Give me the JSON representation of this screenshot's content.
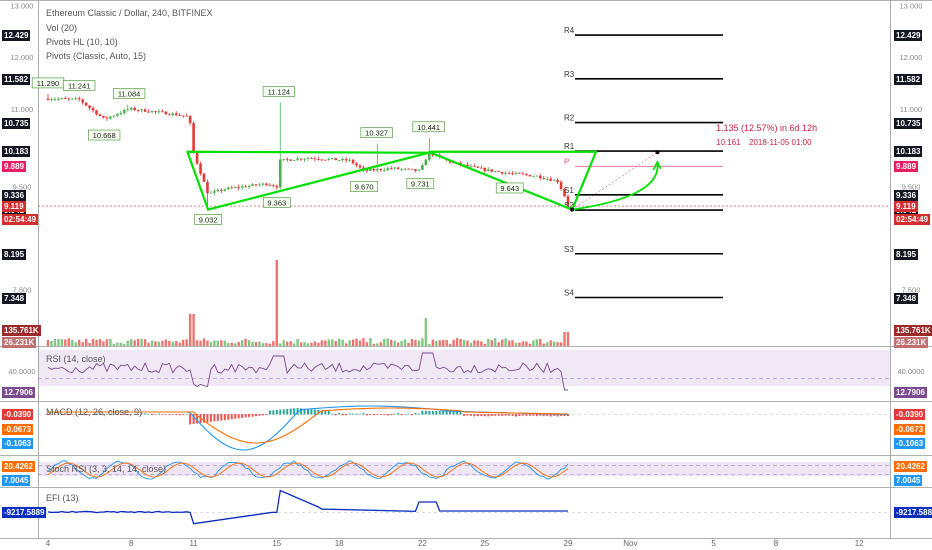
{
  "legend": {
    "title": "Ethereum Classic / Dollar, 240, BITFINEX",
    "vol": "Vol (20)",
    "pivots_hl": "Pivots HL (10, 10)",
    "pivots_classic": "Pivots (Classic, Auto, 15)",
    "rsi": "RSI (14, close)",
    "macd": "MACD (12, 26, close, 9)",
    "stoch": "Stoch RSI (3, 3, 14, 14, close)",
    "efi": "EFI (13)"
  },
  "annotation": {
    "measure": "1.135 (12.57%) in 6d 12h",
    "target_price": "10.161",
    "target_date": "2018-11-05  01:00"
  },
  "countdown": "02:54:49",
  "colors": {
    "up": "#4caf50",
    "down": "#e53935",
    "pattern": "#00e000",
    "pivot": "#000000",
    "rsi": "#7b4a8f",
    "macd": "#2196f3",
    "signal": "#ff6d00",
    "efi": "#0b2fbf",
    "price_tag": "#d32f2f",
    "black_tag": "#131722"
  },
  "chart_data": {
    "type": "candlestick",
    "price_axis": {
      "ticks": [
        "13.000",
        "12.429",
        "12.000",
        "11.582",
        "11.000",
        "10.735",
        "10.183",
        "9.889",
        "9.500",
        "9.336",
        "9.119",
        "9.042",
        "8.195",
        "7.500",
        "7.348"
      ],
      "range": [
        7.0,
        13.05
      ]
    },
    "x_axis": {
      "tick_labels": [
        "4",
        "8",
        "11",
        "15",
        "18",
        "22",
        "25",
        "29",
        "Nov",
        "5",
        "8",
        "12"
      ]
    },
    "last_price": 9.119,
    "pivots_classic": [
      {
        "label": "R4",
        "value": 12.429
      },
      {
        "label": "R3",
        "value": 11.582
      },
      {
        "label": "R2",
        "value": 10.735
      },
      {
        "label": "R1",
        "value": 10.183
      },
      {
        "label": "P",
        "value": 9.889
      },
      {
        "label": "S1",
        "value": 9.336
      },
      {
        "label": "S2",
        "value": 9.042
      },
      {
        "label": "S3",
        "value": 8.195
      },
      {
        "label": "S4",
        "value": 7.348
      }
    ],
    "pivots_hl": {
      "highs": [
        {
          "day": 4.0,
          "value": "11.290"
        },
        {
          "day": 5.5,
          "value": "11.241"
        },
        {
          "day": 7.9,
          "value": "11.084"
        },
        {
          "day": 15.1,
          "value": "11.124"
        },
        {
          "day": 19.8,
          "value": "10.327"
        },
        {
          "day": 22.3,
          "value": "10.441"
        }
      ],
      "lows": [
        {
          "day": 6.7,
          "value": "10.668"
        },
        {
          "day": 11.7,
          "value": "9.032"
        },
        {
          "day": 15.0,
          "value": "9.363"
        },
        {
          "day": 19.2,
          "value": "9.670"
        },
        {
          "day": 21.9,
          "value": "9.731"
        },
        {
          "day": 26.2,
          "value": "9.643"
        }
      ]
    },
    "volume": {
      "tags": [
        "135.761K",
        "26.231K"
      ]
    },
    "rsi": {
      "tags": [
        "40.0000",
        "12.7906"
      ]
    },
    "macd": {
      "tags": [
        "-0.0390",
        "-0.0673",
        "-0.1063"
      ]
    },
    "stoch_rsi": {
      "tags": [
        "20.4262",
        "7.0045"
      ]
    },
    "efi": {
      "tags": [
        "-9217.5889"
      ]
    }
  }
}
